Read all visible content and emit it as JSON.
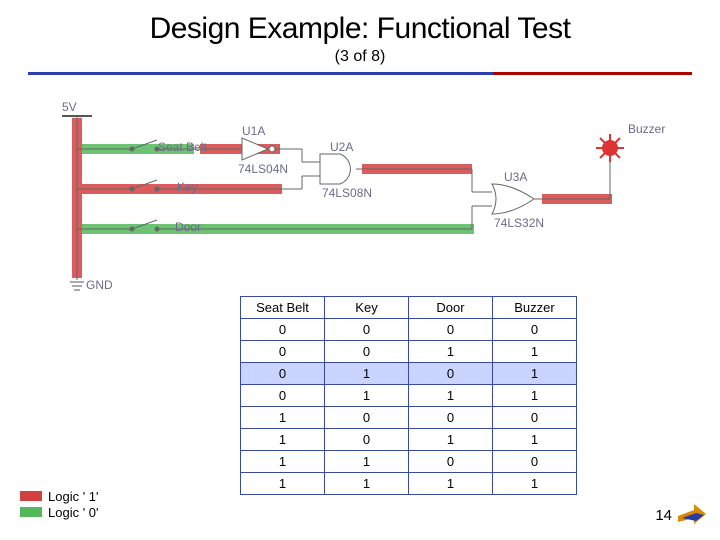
{
  "title": "Design Example: Functional Test",
  "subtitle": "(3 of 8)",
  "circuit": {
    "power": "5V",
    "ground": "GND",
    "inputs": [
      "Seat Belt",
      "Key",
      "Door"
    ],
    "gates": {
      "u1a": "U1A",
      "u1a_part": "74LS04N",
      "u2a": "U2A",
      "u2a_part": "74LS08N",
      "u3a": "U3A",
      "u3a_part": "74LS32N"
    },
    "output": "Buzzer"
  },
  "table": {
    "headers": [
      "Seat Belt",
      "Key",
      "Door",
      "Buzzer"
    ],
    "rows": [
      [
        0,
        0,
        0,
        0
      ],
      [
        0,
        0,
        1,
        1
      ],
      [
        0,
        1,
        0,
        1
      ],
      [
        0,
        1,
        1,
        1
      ],
      [
        1,
        0,
        0,
        0
      ],
      [
        1,
        0,
        1,
        1
      ],
      [
        1,
        1,
        0,
        0
      ],
      [
        1,
        1,
        1,
        1
      ]
    ],
    "highlight_row": 2
  },
  "legend": {
    "hi": "Logic ' 1'",
    "lo": "Logic ' 0'"
  },
  "page": "14",
  "chart_data": {
    "type": "table",
    "title": "Truth table for buzzer circuit",
    "columns": [
      "Seat Belt",
      "Key",
      "Door",
      "Buzzer"
    ],
    "rows": [
      [
        0,
        0,
        0,
        0
      ],
      [
        0,
        0,
        1,
        1
      ],
      [
        0,
        1,
        0,
        1
      ],
      [
        0,
        1,
        1,
        1
      ],
      [
        1,
        0,
        0,
        0
      ],
      [
        1,
        0,
        1,
        1
      ],
      [
        1,
        1,
        0,
        0
      ],
      [
        1,
        1,
        1,
        1
      ]
    ]
  }
}
